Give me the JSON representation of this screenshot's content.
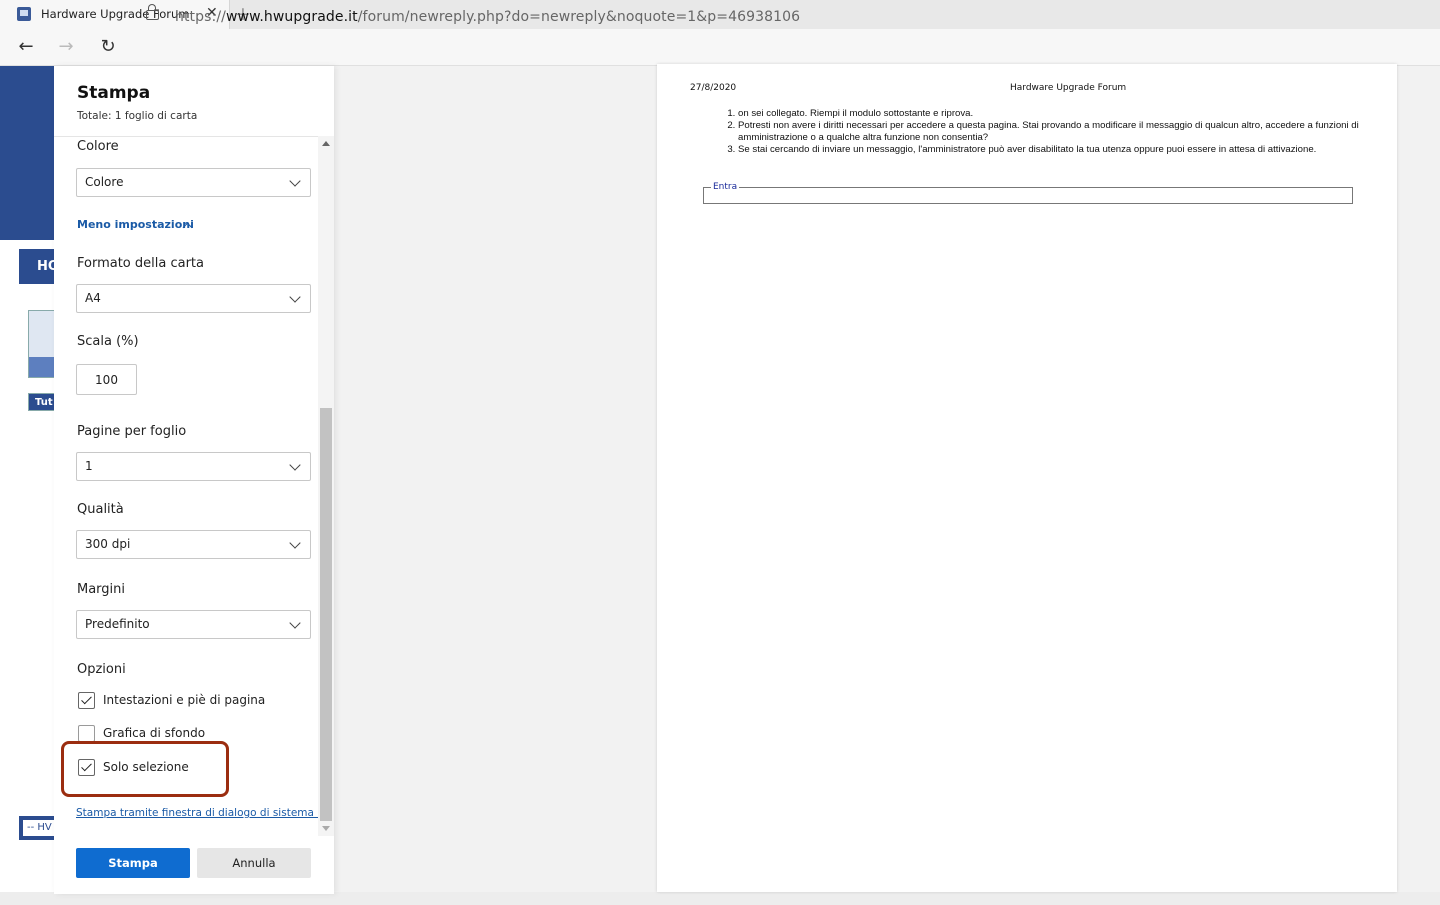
{
  "browser": {
    "tab_title": "Hardware Upgrade Forum",
    "tab_close": "✕",
    "new_tab": "+",
    "url_prefix": "https://",
    "url_domain": "www.hwupgrade.it",
    "url_path": "/forum/newreply.php?do=newreply&noquote=1&p=46938106"
  },
  "background_page": {
    "ho_text": "HO",
    "tut_text": "Tut",
    "hw_text": "-- HV"
  },
  "print_panel": {
    "title": "Stampa",
    "total": "Totale: 1 foglio di carta",
    "color_label": "Colore",
    "color_value": "Colore",
    "less_settings": "Meno impostazioni",
    "paper_label": "Formato della carta",
    "paper_value": "A4",
    "scale_label": "Scala (%)",
    "scale_value": "100",
    "pages_per_sheet_label": "Pagine per foglio",
    "pages_per_sheet_value": "1",
    "quality_label": "Qualità",
    "quality_value": "300 dpi",
    "margins_label": "Margini",
    "margins_value": "Predefinito",
    "options_label": "Opzioni",
    "options": [
      {
        "label": "Intestazioni e piè di pagina",
        "checked": true
      },
      {
        "label": "Grafica di sfondo",
        "checked": false
      },
      {
        "label": "Solo selezione",
        "checked": true
      }
    ],
    "system_dialog_link": "Stampa tramite finestra di dialogo di sistema (...",
    "print_button": "Stampa",
    "cancel_button": "Annulla",
    "highlight_color": "#9b2d10",
    "accent_color": "#0f6cd0"
  },
  "preview": {
    "date": "27/8/2020",
    "header_title": "Hardware Upgrade Forum",
    "messages": [
      "on sei collegato. Riempi il modulo sottostante e riprova.",
      "Potresti non avere i diritti necessari per accedere a questa pagina. Stai provando a modificare il messaggio di qualcun altro, accedere a funzioni di amministrazione o a qualche altra funzione non consentia?",
      "Se stai cercando di inviare un messaggio, l'amministratore può aver disabilitato la tua utenza oppure puoi essere in attesa di attivazione."
    ],
    "fieldset_legend": "Entra"
  }
}
